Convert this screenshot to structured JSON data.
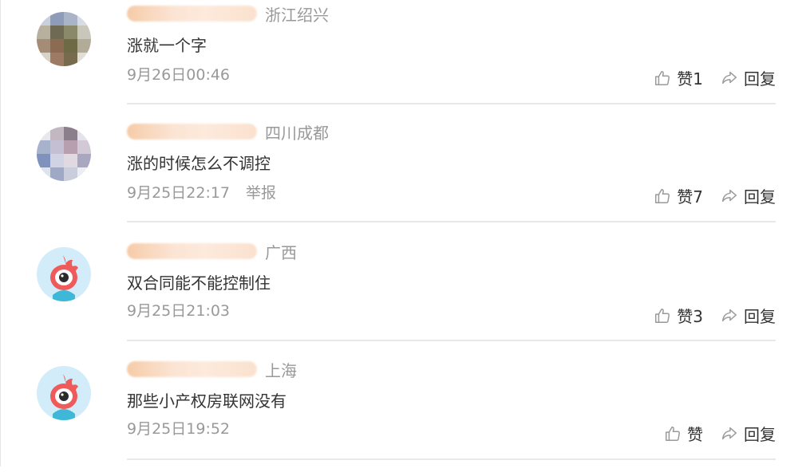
{
  "comments": [
    {
      "location": "浙江绍兴",
      "text": "涨就一个字",
      "time": "9月26日00:46",
      "report": "",
      "like_label": "赞1",
      "reply_label": "回复",
      "avatar": "photo"
    },
    {
      "location": "四川成都",
      "text": "涨的时候怎么不调控",
      "time": "9月25日22:17",
      "report": "举报",
      "like_label": "赞7",
      "reply_label": "回复",
      "avatar": "photo"
    },
    {
      "location": "广西",
      "text": "双合同能不能控制住",
      "time": "9月25日21:03",
      "report": "",
      "like_label": "赞3",
      "reply_label": "回复",
      "avatar": "weibo-default"
    },
    {
      "location": "上海",
      "text": "那些小产权房联网没有",
      "time": "9月25日19:52",
      "report": "",
      "like_label": "赞",
      "reply_label": "回复",
      "avatar": "weibo-default"
    }
  ],
  "colors": {
    "text": "#333333",
    "muted": "#999999",
    "divider": "#e8e8e8",
    "name_blur": "#f6c9a4"
  },
  "icons": {
    "like": "thumbs-up-icon",
    "reply": "share-arrow-icon",
    "default_avatar": "weibo-eye-avatar"
  }
}
